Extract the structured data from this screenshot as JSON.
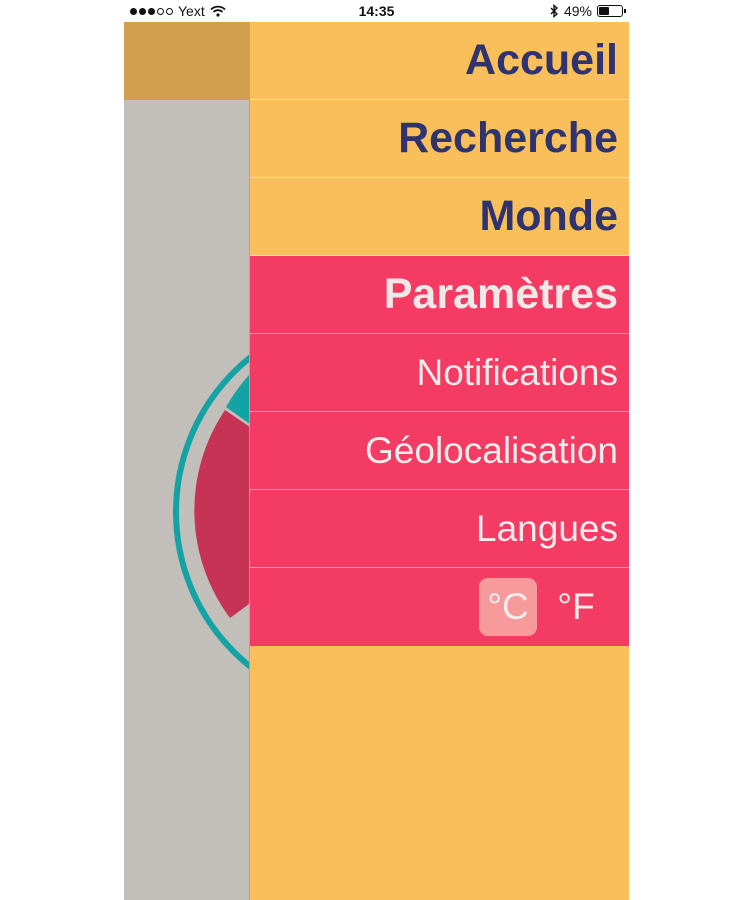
{
  "status_bar": {
    "carrier": "Yext",
    "time": "14:35",
    "battery": "49%",
    "battery_level": 0.49,
    "signal_bars": 3
  },
  "menu": {
    "items": [
      {
        "label": "Accueil"
      },
      {
        "label": "Recherche"
      },
      {
        "label": "Monde"
      },
      {
        "label": "Paramètres"
      }
    ],
    "active": "Paramètres"
  },
  "settings": {
    "items": [
      {
        "label": "Notifications"
      },
      {
        "label": "Géolocalisation"
      },
      {
        "label": "Langues"
      }
    ],
    "units": {
      "celsius": "°C",
      "fahrenheit": "°F",
      "selected": "celsius"
    }
  },
  "colors": {
    "drawer": "#f8bf5a",
    "active": "#f33b64",
    "menu_text": "#2f3470",
    "active_text": "#f1e9e7",
    "selected_unit": "#f79a9c",
    "background": "#c2bfbb",
    "header": "#d19f4f",
    "ring": "#13a3a4"
  }
}
